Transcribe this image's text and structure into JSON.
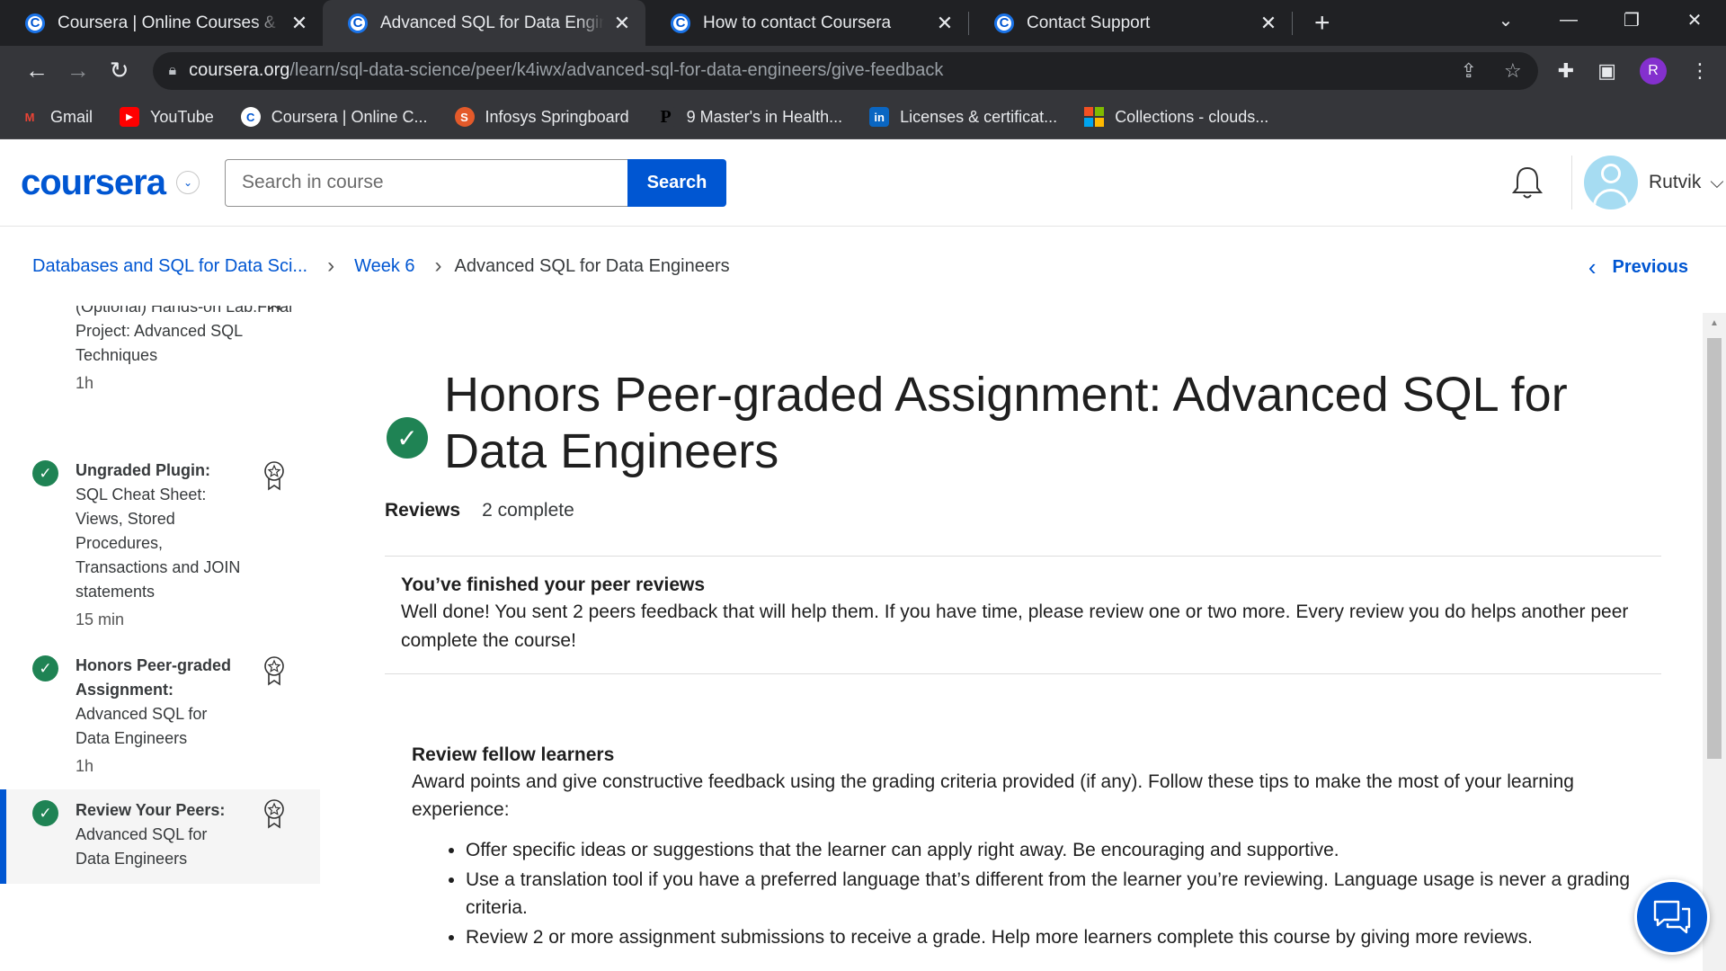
{
  "browser": {
    "tabs": [
      {
        "title": "Coursera | Online Courses & Credentials",
        "active": false
      },
      {
        "title": "Advanced SQL for Data Engineers",
        "active": true
      },
      {
        "title": "How to contact Coursera",
        "active": false
      },
      {
        "title": "Contact Support",
        "active": false
      }
    ],
    "url_host": "coursera.org",
    "url_path": "/learn/sql-data-science/peer/k4iwx/advanced-sql-for-data-engineers/give-feedback",
    "profile_initial": "R",
    "bookmarks": [
      {
        "label": "Gmail",
        "icon": "gmail-icon",
        "color": "#ea4335"
      },
      {
        "label": "YouTube",
        "icon": "youtube-icon",
        "color": "#ff0000"
      },
      {
        "label": "Coursera | Online C...",
        "icon": "coursera-icon",
        "color": "#0056d2"
      },
      {
        "label": "Infosys Springboard",
        "icon": "infosys-icon",
        "color": "#e45a2a"
      },
      {
        "label": "9 Master's in Health...",
        "icon": "p-icon",
        "color": "#000000"
      },
      {
        "label": "Licenses & certificat...",
        "icon": "linkedin-icon",
        "color": "#0a66c2"
      },
      {
        "label": "Collections - clouds...",
        "icon": "microsoft-icon",
        "color": "#f25022"
      }
    ]
  },
  "header": {
    "logo": "coursera",
    "search_placeholder": "Search in course",
    "search_button": "Search",
    "user_name": "Rutvik"
  },
  "breadcrumb": {
    "course": "Databases and SQL for Data Sci...",
    "week": "Week 6",
    "current": "Advanced SQL for Data Engineers",
    "previous": "Previous"
  },
  "sidebar": {
    "items": [
      {
        "label": "",
        "text": "(Optional) Hands-on Lab:Final Project: Advanced SQL Techniques",
        "duration": "1h",
        "active": false
      },
      {
        "label": "Ungraded Plugin:",
        "text": "SQL Cheat Sheet: Views, Stored Procedures, Transactions and JOIN statements",
        "duration": "15 min",
        "active": false
      },
      {
        "label": "Honors Peer-graded Assignment:",
        "text": "Advanced SQL for Data Engineers",
        "duration": "1h",
        "active": false
      },
      {
        "label": "Review Your Peers:",
        "text": "Advanced SQL for Data Engineers",
        "duration": "",
        "active": true
      }
    ]
  },
  "main": {
    "title": "Honors Peer-graded Assignment: Advanced SQL for Data Engineers",
    "reviews_label": "Reviews",
    "reviews_status": "2 complete",
    "done_heading": "You’ve finished your peer reviews",
    "done_text": "Well done! You sent 2 peers feedback that will help them. If you have time, please review one or two more. Every review you do helps another peer complete the course!",
    "review_heading": "Review fellow learners",
    "review_text": "Award points and give constructive feedback using the grading criteria provided (if any). Follow these tips to make the most of your learning experience:",
    "tips": [
      "Offer specific ideas or suggestions that the learner can apply right away. Be encouraging and supportive.",
      "Use a translation tool if you have a preferred language that’s different from the learner you’re reviewing. Language usage is never a grading criteria.",
      "Review 2 or more assignment submissions to receive a grade. Help more learners complete this course by giving more reviews."
    ]
  },
  "colors": {
    "brand": "#0056d2",
    "success": "#1f8354"
  }
}
